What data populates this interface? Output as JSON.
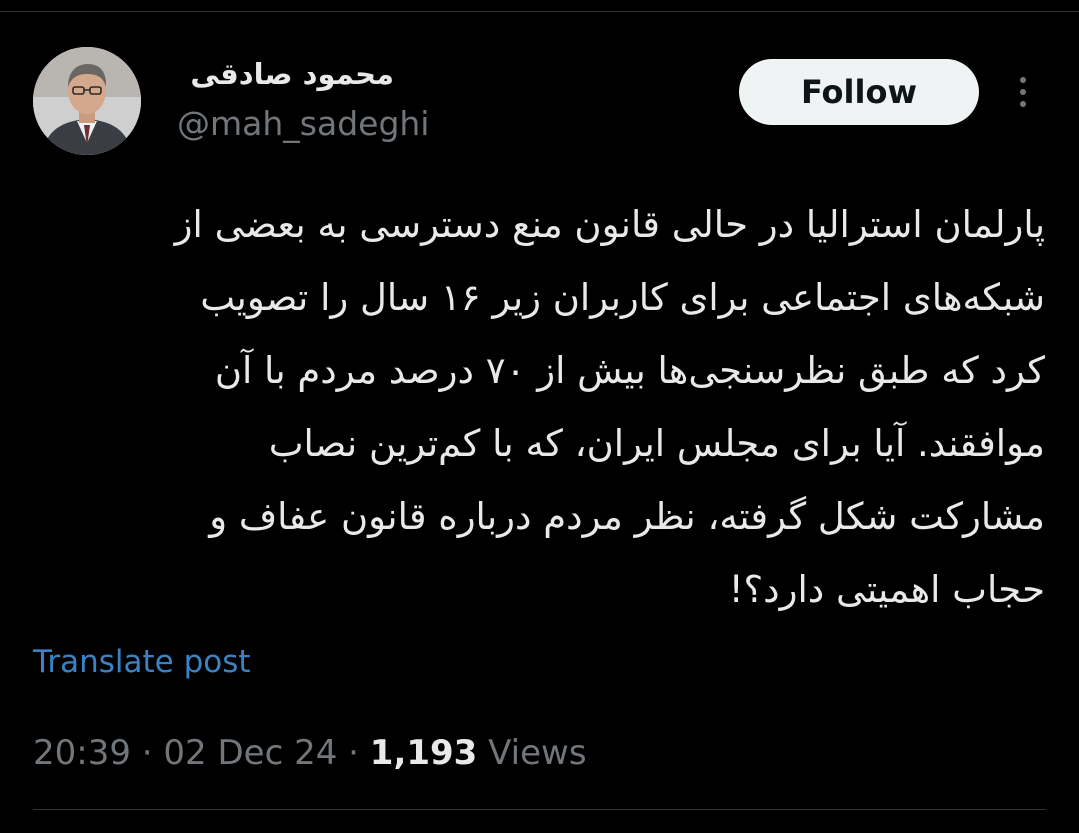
{
  "author": {
    "display_name": "محمود صادقی",
    "handle": "@mah_sadeghi",
    "avatar_icon": "profile-photo"
  },
  "actions": {
    "follow_label": "Follow",
    "more_icon": "more-vertical-icon"
  },
  "post": {
    "lines": [
      "پارلمان استرالیا در حالی قانون منع دسترسی به بعضی از",
      "شبکه‌های اجتماعی برای کاربران زیر ۱۶ سال را تصویب",
      "کرد که طبق نظرسنجی‌ها بیش از ۷۰ درصد مردم با آن",
      "موافقند. آیا برای مجلس ایران، که با کم‌ترین نصاب",
      "مشارکت شکل گرفته، نظر مردم درباره قانون عفاف و",
      "حجاب اهمیتی دارد؟!"
    ]
  },
  "translate_label": "Translate post",
  "meta": {
    "time": "20:39",
    "separator": "·",
    "date": "02 Dec 24",
    "views_count": "1,193",
    "views_label": "Views"
  },
  "colors": {
    "background": "#000000",
    "text_primary": "#e7e9ea",
    "text_secondary": "#71767b",
    "link": "#3b82c4",
    "follow_bg": "#eff3f4",
    "divider": "#2f3336"
  }
}
